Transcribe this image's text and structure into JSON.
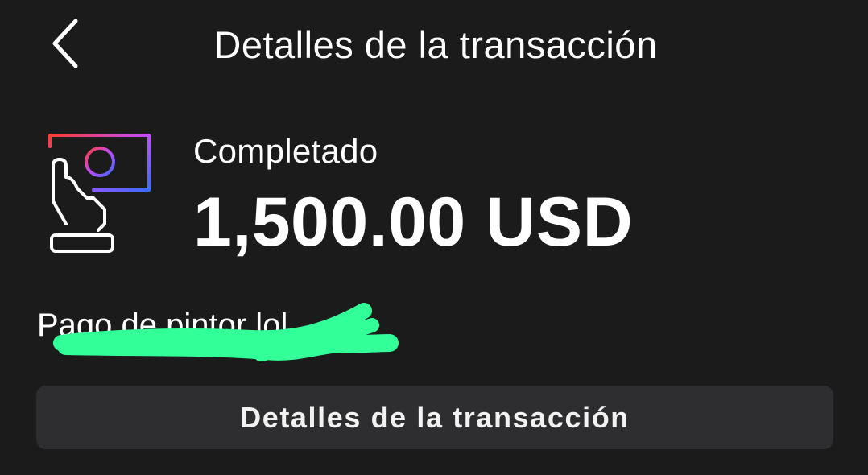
{
  "header": {
    "back_icon": "chevron-left-icon",
    "title": "Detalles de la transacción"
  },
  "transaction": {
    "status_icon": "hand-card-icon",
    "status": "Completado",
    "amount": "1,500.00 USD",
    "description": "Pago de pintor lol___n"
  },
  "actions": {
    "details_button_label": "Detalles de la transacción"
  },
  "colors": {
    "background": "#1b1b1c",
    "button_background": "#2e2e30",
    "text": "#ffffff",
    "redaction_marker": "#33ff99",
    "icon_gradient_start": "#ff3b2f",
    "icon_gradient_mid": "#b14dff",
    "icon_gradient_end": "#3b6bff"
  }
}
